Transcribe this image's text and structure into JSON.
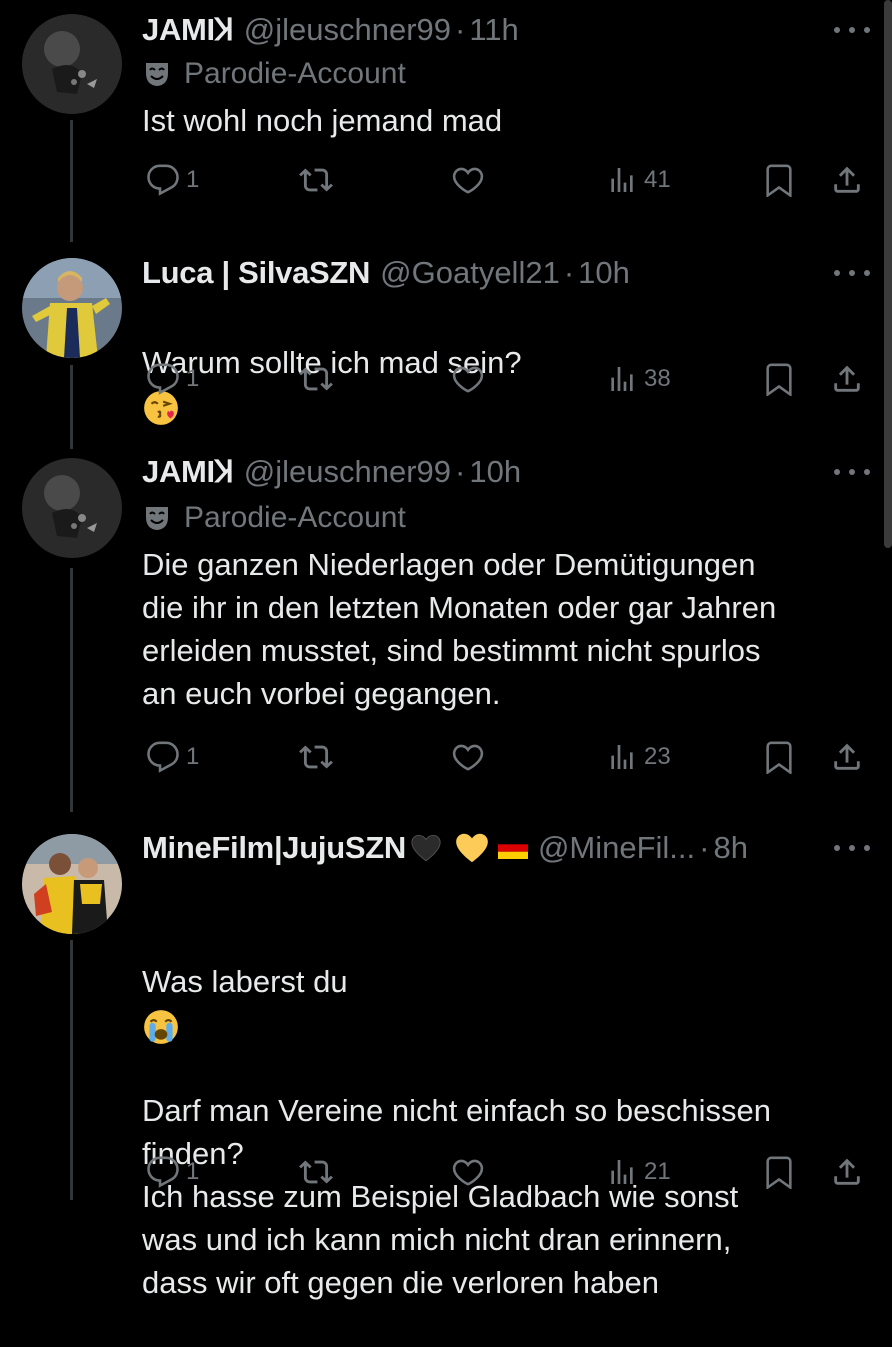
{
  "tweets": [
    {
      "name": "JAMIꞰ",
      "handle": "@jleuschner99",
      "dot": "·",
      "time": "11h",
      "parody_label": "Parodie-Account",
      "text": "Ist wohl noch jemand mad",
      "replies": "1",
      "views": "41"
    },
    {
      "name": "Luca | SilvaSZN",
      "handle": "@Goatyell21",
      "dot": "·",
      "time": "10h",
      "text": "Warum sollte ich mad sein?",
      "text_emoji": "face-blowing-a-kiss",
      "replies": "1",
      "views": "38"
    },
    {
      "name": "JAMIꞰ",
      "handle": "@jleuschner99",
      "dot": "·",
      "time": "10h",
      "parody_label": "Parodie-Account",
      "text": "Die ganzen Niederlagen oder Demütigungen\ndie ihr in den letzten Monaten oder gar Jahren\nerleiden musstet, sind bestimmt nicht spurlos\nan euch vorbei gegangen.",
      "replies": "1",
      "views": "23"
    },
    {
      "name": "MineFilm|JujuSZN",
      "name_emojis": [
        "black-heart",
        "yellow-heart",
        "flag-germany"
      ],
      "handle": "@MineFil...",
      "dot": "·",
      "time": "8h",
      "text_line1": "Was laberst du",
      "text_emoji": "loudly-crying-face",
      "text_rest": "Darf man Vereine nicht einfach so beschissen\nfinden?\nIch hasse zum Beispiel Gladbach wie sonst\nwas und ich kann mich nicht dran erinnern,\ndass wir oft gegen die verloren haben",
      "replies": "1",
      "views": "21"
    }
  ],
  "colors": {
    "background": "#000000",
    "text": "#e7e9ea",
    "secondary": "#71767b",
    "thread_line": "#333639"
  }
}
